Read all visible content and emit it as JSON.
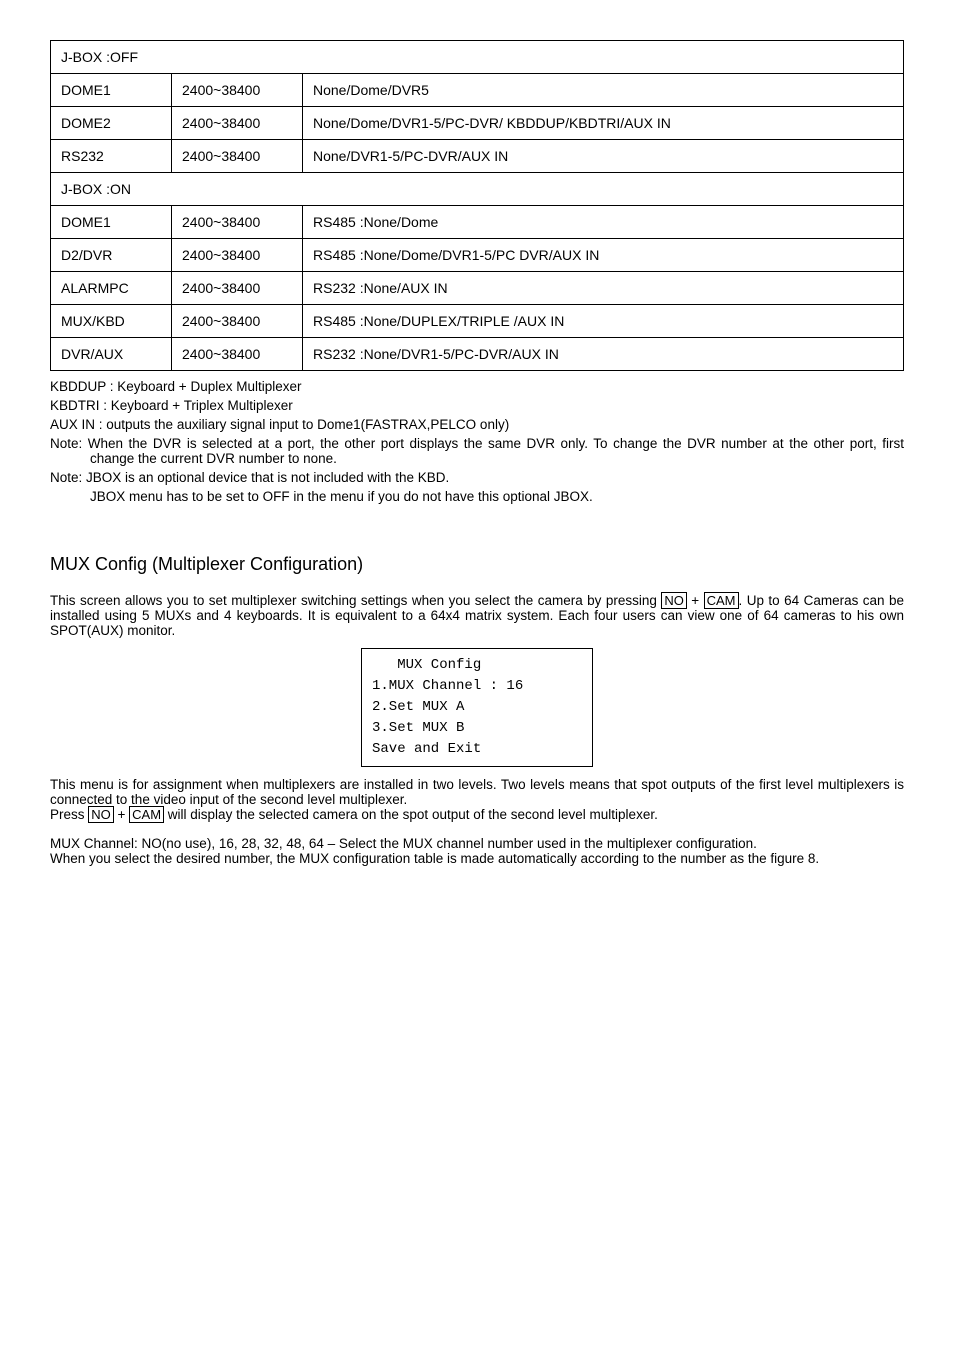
{
  "table": {
    "header1": "J-BOX :OFF",
    "rows1": [
      {
        "c1": "DOME1",
        "c2": "2400~38400",
        "c3": "None/Dome/DVR5"
      },
      {
        "c1": "DOME2",
        "c2": "2400~38400",
        "c3": "None/Dome/DVR1-5/PC-DVR/ KBDDUP/KBDTRI/AUX IN"
      },
      {
        "c1": "RS232",
        "c2": "2400~38400",
        "c3": "None/DVR1-5/PC-DVR/AUX IN"
      }
    ],
    "header2": "J-BOX :ON",
    "rows2": [
      {
        "c1": "DOME1",
        "c2": "2400~38400",
        "c3": "RS485 :None/Dome"
      },
      {
        "c1": "D2/DVR",
        "c2": "2400~38400",
        "c3": "RS485 :None/Dome/DVR1-5/PC DVR/AUX IN"
      },
      {
        "c1": "ALARMPC",
        "c2": "2400~38400",
        "c3": "RS232 :None/AUX IN"
      },
      {
        "c1": "MUX/KBD",
        "c2": "2400~38400",
        "c3": "RS485 :None/DUPLEX/TRIPLE /AUX IN"
      },
      {
        "c1": "DVR/AUX",
        "c2": "2400~38400",
        "c3": "RS232 :None/DVR1-5/PC-DVR/AUX IN"
      }
    ]
  },
  "notes": {
    "n1": "KBDDUP : Keyboard + Duplex Multiplexer",
    "n2": "KBDTRI : Keyboard + Triplex Multiplexer",
    "n3": "AUX IN : outputs the auxiliary signal input to Dome1(FASTRAX,PELCO only)",
    "n4": "Note: When the DVR is selected at a port, the other port displays the same DVR only. To change the DVR number at the other port, first change the current DVR number to none.",
    "n5": "Note: JBOX is an optional device that is not included with the KBD.",
    "n6": "JBOX menu has to be set to OFF in the menu if you do not have this optional JBOX."
  },
  "section_title": "MUX Config (Multiplexer Configuration)",
  "intro": {
    "part1": "This screen allows you to set multiplexer switching settings when you select the camera by pressing ",
    "key1": "NO",
    "plus": " + ",
    "key2": "CAM",
    "part2": ". Up to 64 Cameras can be installed using 5 MUXs and 4 keyboards. It is equivalent to a 64x4 matrix system. Each four users can view one of 64 cameras to his own SPOT(AUX) monitor."
  },
  "config_box": {
    "l1": "   MUX Config",
    "l2": "1.MUX Channel : 16",
    "l3": "2.Set MUX A",
    "l4": "3.Set MUX B",
    "l5": "Save and Exit"
  },
  "below": {
    "p1": "This menu is for assignment when multiplexers are installed in two levels. Two levels means that spot outputs of the first level multiplexers is connected to the video input of the second level multiplexer.",
    "p2a": "Press ",
    "p2key1": "NO",
    "p2plus": " + ",
    "p2key2": "CAM",
    "p2b": " will display the selected camera on the spot output of the second level multiplexer.",
    "p3": "MUX Channel: NO(no use), 16, 28, 32, 48, 64 – Select the MUX channel number used in the multiplexer configuration.",
    "p4": "When you select the desired number, the MUX configuration table is made automatically according to the number as the figure 8."
  }
}
